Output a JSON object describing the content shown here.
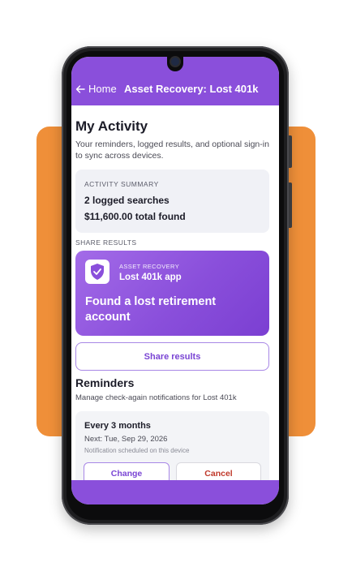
{
  "colors": {
    "brand_purple": "#8a4fdb",
    "backdrop_orange": "#ef8f39",
    "cancel_red": "#c0392b"
  },
  "appbar": {
    "back_icon": "arrow-left-icon",
    "back_label": "Home",
    "title": "Asset Recovery: Lost 401k"
  },
  "page": {
    "title": "My Activity",
    "subtitle": "Your reminders, logged results, and optional sign-in to sync across devices."
  },
  "summary": {
    "caption": "ACTIVITY SUMMARY",
    "searches": "2 logged searches",
    "total": "$11,600.00 total found"
  },
  "share": {
    "caption": "SHARE RESULTS",
    "card": {
      "icon": "shield-check-icon",
      "brand": "ASSET RECOVERY",
      "app_name": "Lost 401k app",
      "headline": "Found a lost retirement account"
    },
    "button_label": "Share results"
  },
  "reminders": {
    "title": "Reminders",
    "subtitle": "Manage check-again notifications for Lost 401k",
    "card": {
      "frequency": "Every 3 months",
      "next": "Next: Tue, Sep 29, 2026",
      "note": "Notification scheduled on this device",
      "change_label": "Change",
      "cancel_label": "Cancel"
    }
  }
}
